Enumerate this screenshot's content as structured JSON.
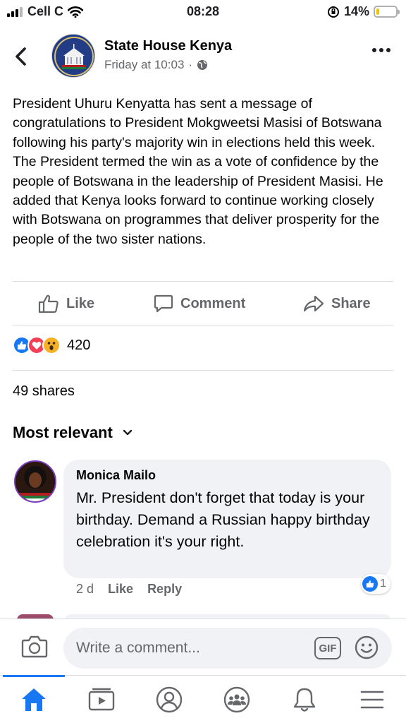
{
  "status_bar": {
    "carrier": "Cell C",
    "time": "08:28",
    "battery_percent": "14%",
    "battery_level": 0.14,
    "battery_color": "#f2c500"
  },
  "header": {
    "page_name": "State House Kenya",
    "post_time": "Friday at 10:03",
    "separator": "·",
    "back_icon": "chevron-left-icon",
    "privacy_icon": "globe-icon",
    "more_icon": "more-horizontal-icon"
  },
  "post": {
    "text": "President Uhuru Kenyatta has sent a message of congratulations to President Mokgweetsi Masisi of Botswana following his party's majority win in elections held this week. The President termed the win as a vote of confidence by the people of Botswana in the leadership of President Masisi. He added that Kenya looks forward to continue working closely with Botswana on programmes that deliver prosperity for the people of the two sister nations."
  },
  "actions": {
    "like_label": "Like",
    "comment_label": "Comment",
    "share_label": "Share"
  },
  "reactions": {
    "types": [
      "like",
      "love",
      "wow"
    ],
    "count": "420"
  },
  "shares": "49 shares",
  "comments_sort": {
    "label": "Most relevant"
  },
  "comments": [
    {
      "author": "Monica Mailo",
      "text": "Mr. President don't forget that today is your birthday. Demand a Russian happy birthday celebration it's your right.",
      "time": "2 d",
      "like_label": "Like",
      "reply_label": "Reply",
      "reaction_count": "1"
    }
  ],
  "composer": {
    "placeholder": "Write a comment...",
    "gif_label": "GIF"
  },
  "tab_bar": {
    "tabs": [
      "home-icon",
      "video-icon",
      "profile-icon",
      "groups-icon",
      "notifications-icon",
      "menu-icon"
    ],
    "active": "home"
  },
  "colors": {
    "accent": "#1877f2",
    "love": "#f33e58",
    "wow": "#f7b125",
    "secondary_text": "#65676b",
    "bubble": "#f0f2f5"
  }
}
